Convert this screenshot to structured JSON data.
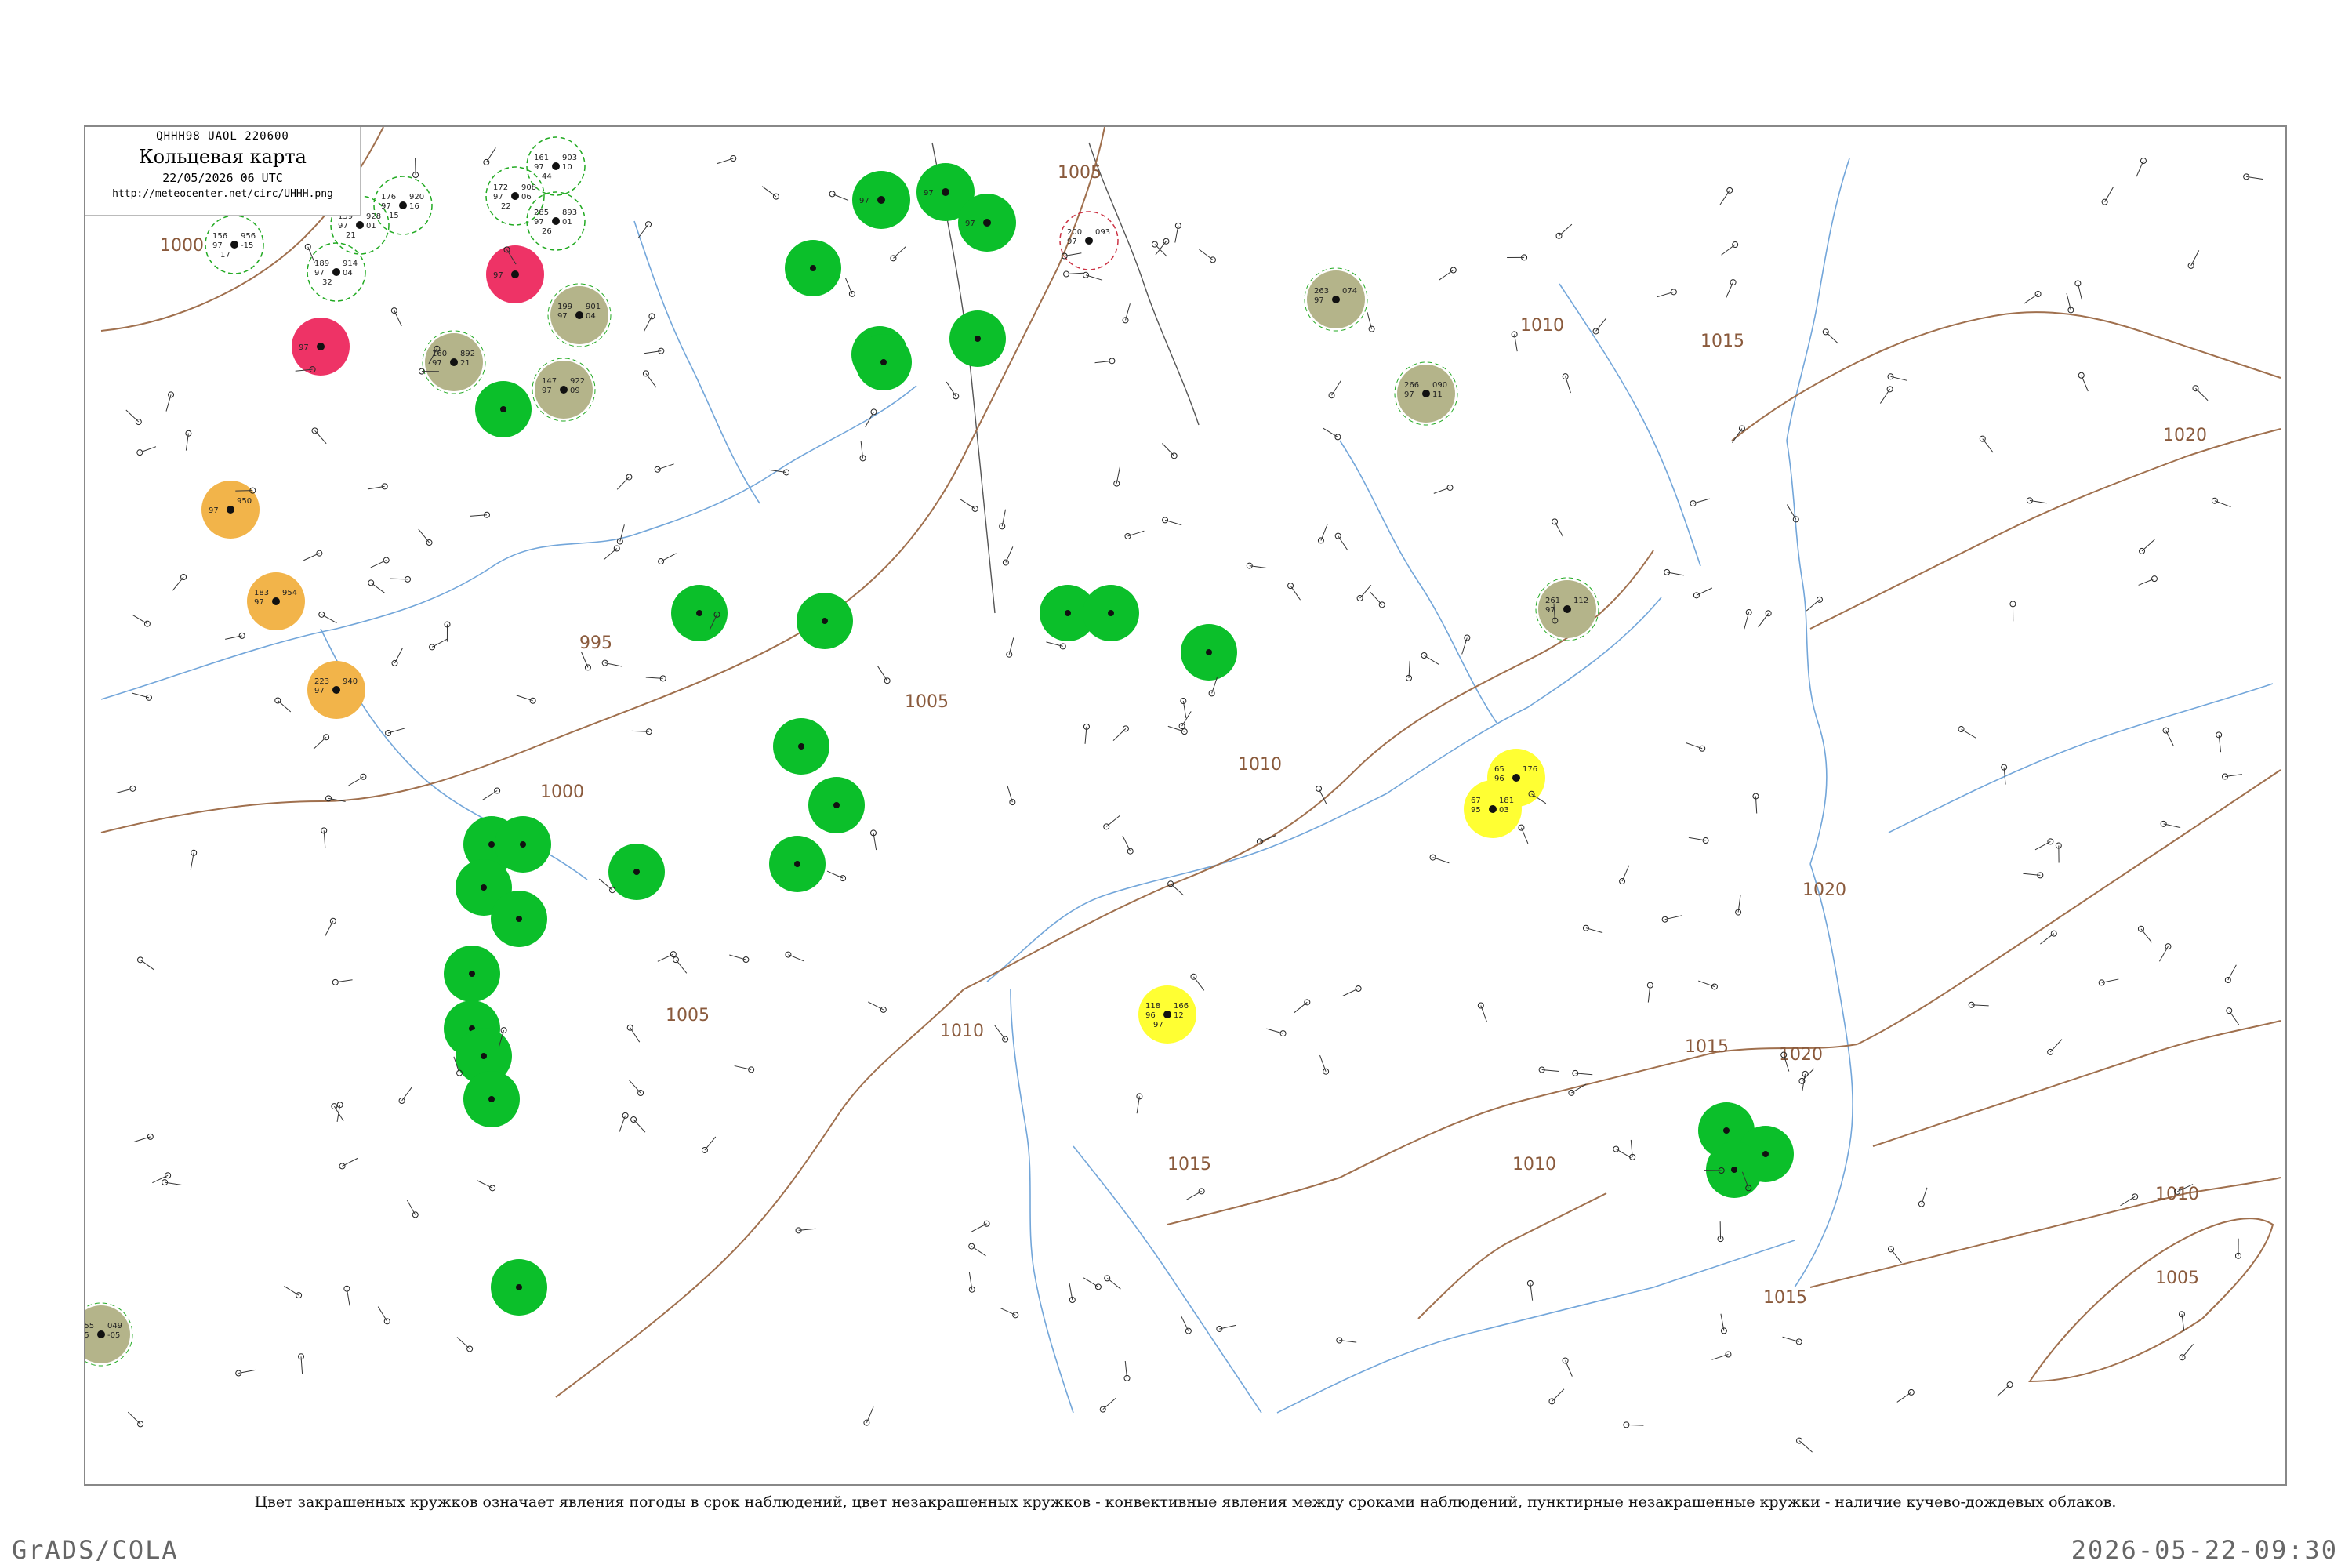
{
  "header": {
    "code": "QHHH98  UAOL  220600",
    "title": "Кольцевая карта",
    "date": "22/05/2026 06 UTC",
    "url": "http://meteocenter.net/circ/UHHH.png"
  },
  "isobars": [
    "1000",
    "995",
    "1005",
    "1000",
    "1005",
    "1010",
    "1010",
    "1015",
    "1015",
    "1010",
    "1005",
    "1010",
    "1015",
    "1020",
    "1020",
    "1020",
    "1015",
    "1005",
    "1010"
  ],
  "colors": {
    "green": "#0bbf2a",
    "olive": "#b4b48a",
    "orange": "#f2b44a",
    "red": "#ee3366",
    "yellow": "#ffff33",
    "isobar": "#a0704e",
    "river": "#4f8fcf",
    "dashed_ring": "#22aa22"
  },
  "stations": [
    {
      "name": "s01",
      "a": "156",
      "b": "956",
      "c": "97",
      "d": "-15",
      "e": "17",
      "kind": "ring"
    },
    {
      "name": "s02",
      "a": "159",
      "b": "928",
      "c": "97",
      "d": "01",
      "e": "21",
      "kind": "ring"
    },
    {
      "name": "s03",
      "a": "176",
      "b": "920",
      "c": "97",
      "d": "16",
      "e": "15",
      "kind": "ring"
    },
    {
      "name": "s04",
      "a": "172",
      "b": "908",
      "c": "97",
      "d": "06",
      "e": "22",
      "kind": "ring"
    },
    {
      "name": "s05",
      "a": "161",
      "b": "903",
      "c": "97",
      "d": "10",
      "e": "44",
      "kind": "ring"
    },
    {
      "name": "s06",
      "a": "285",
      "b": "893",
      "c": "97",
      "d": "01",
      "e": "26",
      "kind": "ring"
    },
    {
      "name": "s07",
      "a": "189",
      "b": "914",
      "c": "97",
      "d": "04",
      "e": "32",
      "kind": "ring"
    },
    {
      "name": "s08",
      "a": "",
      "b": "",
      "c": "97",
      "d": "",
      "e": "",
      "kind": "red"
    },
    {
      "name": "s09",
      "a": "",
      "b": "",
      "c": "97",
      "d": "",
      "e": "",
      "kind": "red"
    },
    {
      "name": "s10",
      "a": "199",
      "b": "901",
      "c": "97",
      "d": "04",
      "e": "",
      "kind": "olive"
    },
    {
      "name": "s11",
      "a": "160",
      "b": "892",
      "c": "97",
      "d": "21",
      "e": "",
      "kind": "olive"
    },
    {
      "name": "s12",
      "a": "147",
      "b": "922",
      "c": "97",
      "d": "09",
      "e": "",
      "kind": "olive"
    },
    {
      "name": "s13",
      "a": "",
      "b": "950",
      "c": "97",
      "d": "",
      "e": "",
      "kind": "orange"
    },
    {
      "name": "s14",
      "a": "183",
      "b": "954",
      "c": "97",
      "d": "",
      "e": "",
      "kind": "orange"
    },
    {
      "name": "s15",
      "a": "223",
      "b": "940",
      "c": "97",
      "d": "",
      "e": "",
      "kind": "orange"
    },
    {
      "name": "s16",
      "a": "",
      "b": "",
      "c": "97",
      "d": "",
      "e": "",
      "kind": "green"
    },
    {
      "name": "s17",
      "a": "",
      "b": "",
      "c": "97",
      "d": "",
      "e": "",
      "kind": "green"
    },
    {
      "name": "s18",
      "a": "",
      "b": "",
      "c": "97",
      "d": "",
      "e": "",
      "kind": "green"
    },
    {
      "name": "s19",
      "a": "200",
      "b": "093",
      "c": "97",
      "d": "",
      "e": "",
      "kind": "ring-red"
    },
    {
      "name": "s20",
      "a": "118",
      "b": "166",
      "c": "96",
      "d": "12",
      "e": "97",
      "kind": "yellow"
    },
    {
      "name": "s21",
      "a": "65",
      "b": "176",
      "c": "96",
      "d": "",
      "e": "",
      "kind": "yellow"
    },
    {
      "name": "s22",
      "a": "67",
      "b": "181",
      "c": "95",
      "d": "03",
      "e": "",
      "kind": "yellow"
    },
    {
      "name": "s23",
      "a": "255",
      "b": "049",
      "c": "95",
      "d": "-05",
      "e": "",
      "kind": "olive"
    },
    {
      "name": "s24",
      "a": "263",
      "b": "074",
      "c": "97",
      "d": "",
      "e": "",
      "kind": "olive"
    },
    {
      "name": "s25",
      "a": "266",
      "b": "090",
      "c": "97",
      "d": "11",
      "e": "",
      "kind": "olive"
    },
    {
      "name": "s26",
      "a": "261",
      "b": "112",
      "c": "97",
      "d": "",
      "e": "",
      "kind": "olive"
    }
  ],
  "caption": "Цвет закрашенных кружков означает явления погоды в срок наблюдений, цвет незакрашенных кружков - конвективные явления между сроками наблюдений, пунктирные незакрашенные кружки - наличие кучево-дождевых облаков.",
  "footer": {
    "left": "GrADS/COLA",
    "right": "2026-05-22-09:30"
  }
}
